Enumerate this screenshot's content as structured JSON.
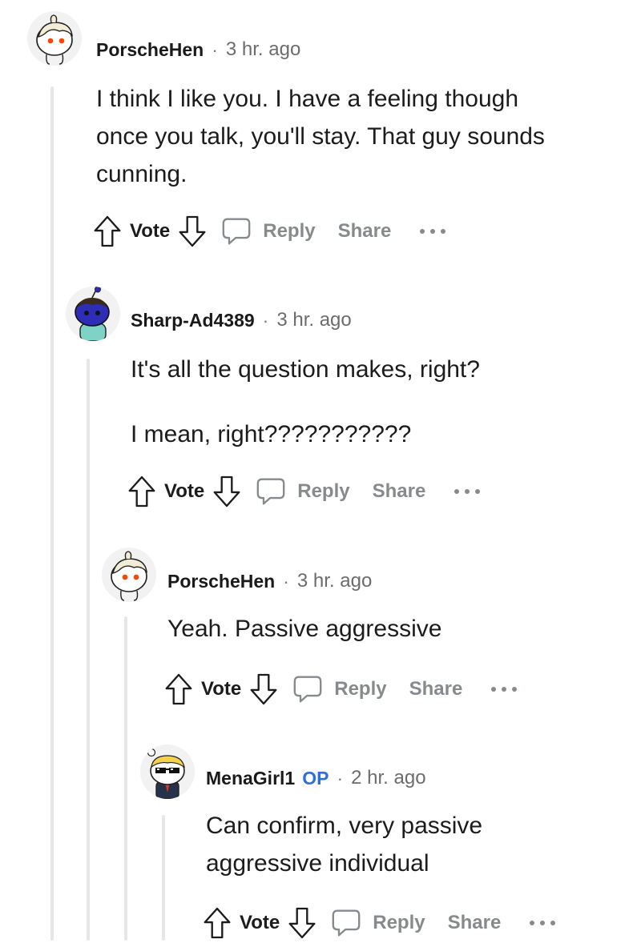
{
  "comments": [
    {
      "username": "PorscheHen",
      "separator": "·",
      "time": "3 hr. ago",
      "body": [
        "I think I like you. I have a feeling though",
        "once you talk, you'll stay. That guy sounds",
        "cunning."
      ]
    },
    {
      "username": "Sharp-Ad4389",
      "separator": "·",
      "time": "3 hr. ago",
      "body": [
        "It's all the question makes, right?",
        "I mean, right???????????"
      ]
    },
    {
      "username": "PorscheHen",
      "separator": "·",
      "time": "3 hr. ago",
      "body": [
        "Yeah. Passive aggressive"
      ]
    },
    {
      "username": "MenaGirl1",
      "badge": "OP",
      "separator": "·",
      "time": "2 hr. ago",
      "body": [
        "Can confirm, very passive",
        "aggressive individual"
      ]
    }
  ],
  "actions": {
    "vote": "Vote",
    "reply": "Reply",
    "share": "Share"
  },
  "icons": {
    "upvote": "arrow-up-icon",
    "downvote": "arrow-down-icon",
    "reply": "speech-bubble-icon",
    "more": "more-dots-icon"
  },
  "colors": {
    "op_badge": "#2f6fd6",
    "muted": "#878a8c",
    "thread_line": "#e6e6e6"
  }
}
